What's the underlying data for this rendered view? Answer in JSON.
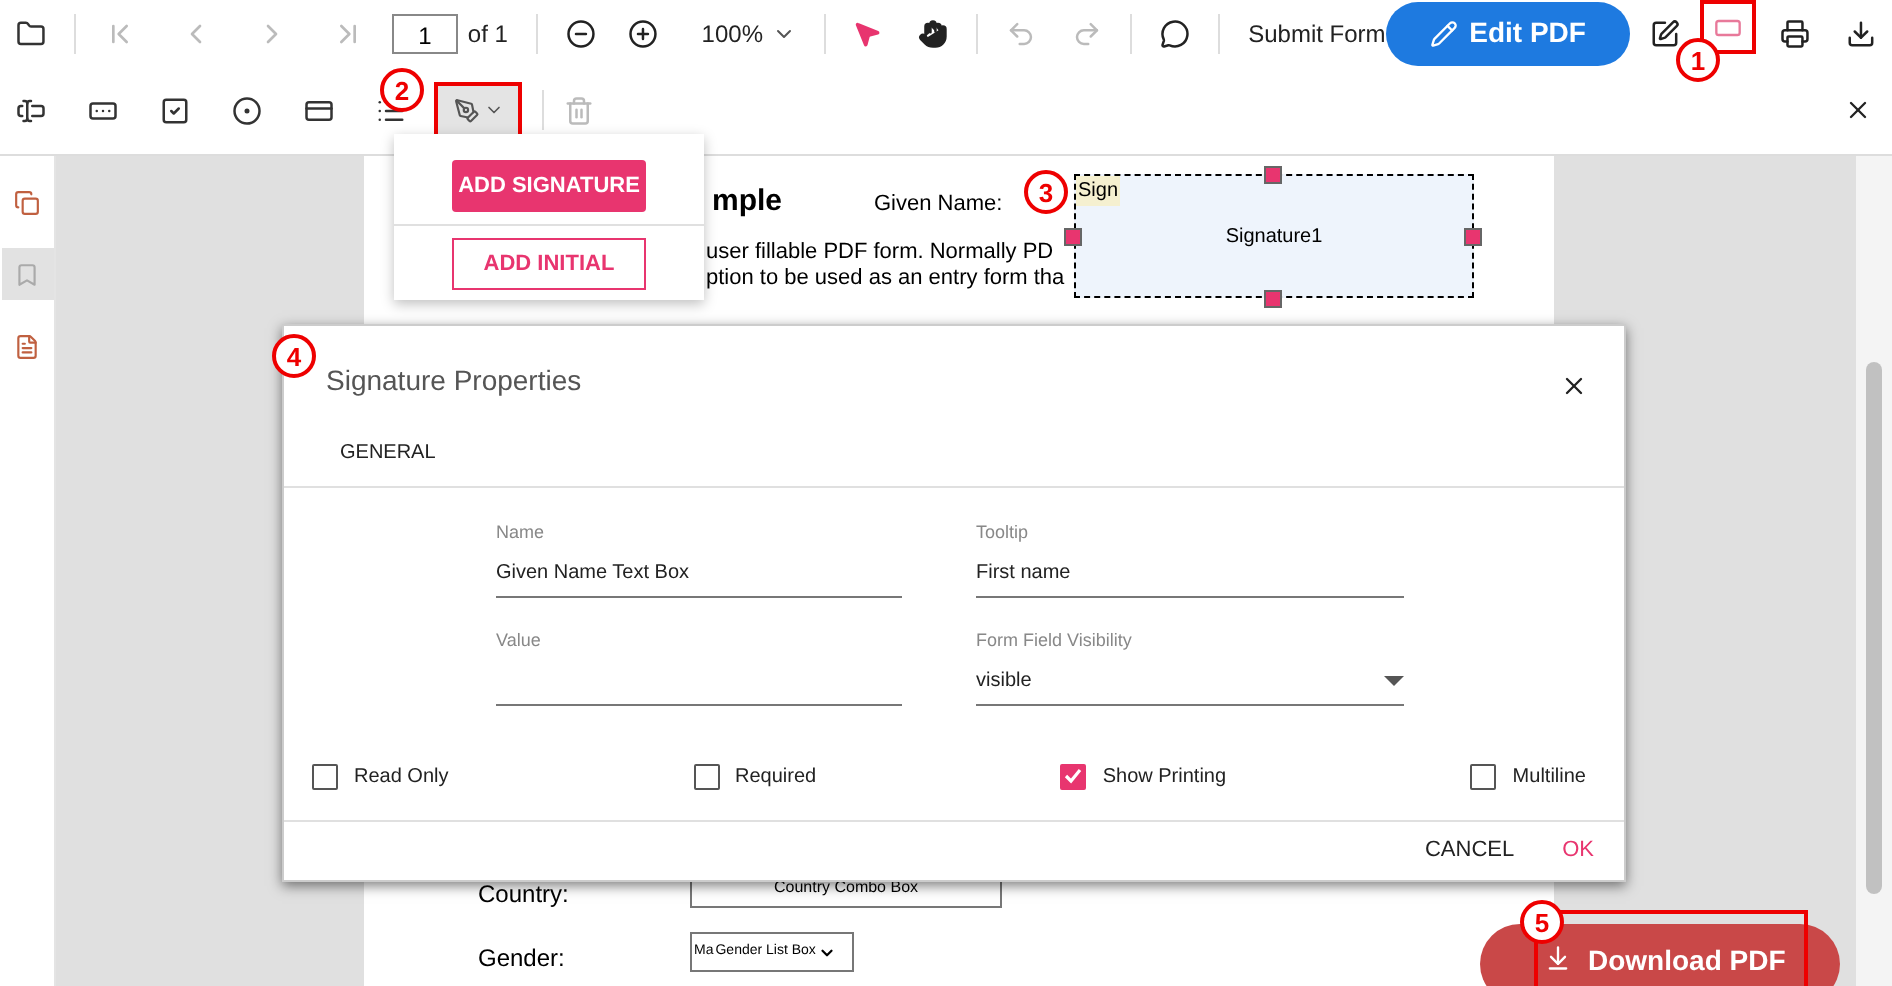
{
  "toolbar": {
    "page_input": "1",
    "page_count": "of 1",
    "zoom": "100%",
    "submit": "Submit Form",
    "edit_pdf": "Edit PDF"
  },
  "signature_menu": {
    "items": [
      {
        "label": "ADD SIGNATURE",
        "kind": "filled"
      },
      {
        "label": "ADD INITIAL",
        "kind": "outline"
      }
    ]
  },
  "sidebar": {
    "items": [
      {
        "kind": "pages",
        "selected": false
      },
      {
        "kind": "bookmark",
        "selected": true
      },
      {
        "kind": "fields",
        "selected": false
      }
    ]
  },
  "document": {
    "heading": "mple",
    "given_name_label": "Given Name:",
    "lines": [
      "user fillable PDF form. Normally PD",
      "ption to be used as an entry form tha"
    ],
    "signature_field": {
      "badge": "Sign",
      "name": "Signature1"
    },
    "country_label": "Country:",
    "country_box": "Country Combo Box",
    "gender_label": "Gender:",
    "gender_value": "Ma",
    "gender_box": "Gender List Box"
  },
  "dialog": {
    "title": "Signature Properties",
    "tabs": [
      {
        "label": "GENERAL",
        "selected": true
      }
    ],
    "fields": [
      {
        "label": "Name",
        "value": "Given Name Text Box",
        "kind": "text"
      },
      {
        "label": "Tooltip",
        "value": "First name",
        "kind": "text"
      },
      {
        "label": "Value",
        "kind": "text"
      },
      {
        "label": "Form Field Visibility",
        "value": "visible",
        "kind": "select"
      }
    ],
    "checkboxes": [
      {
        "label": "Read Only",
        "checked": false
      },
      {
        "label": "Required",
        "checked": false
      },
      {
        "label": "Show Printing",
        "checked": true
      },
      {
        "label": "Multiline",
        "checked": false
      }
    ],
    "buttons": [
      {
        "label": "CANCEL",
        "kind": "plain"
      },
      {
        "label": "OK",
        "kind": "primary"
      }
    ]
  },
  "download_button": "Download PDF",
  "callouts": [
    "1",
    "2",
    "3",
    "4",
    "5"
  ]
}
